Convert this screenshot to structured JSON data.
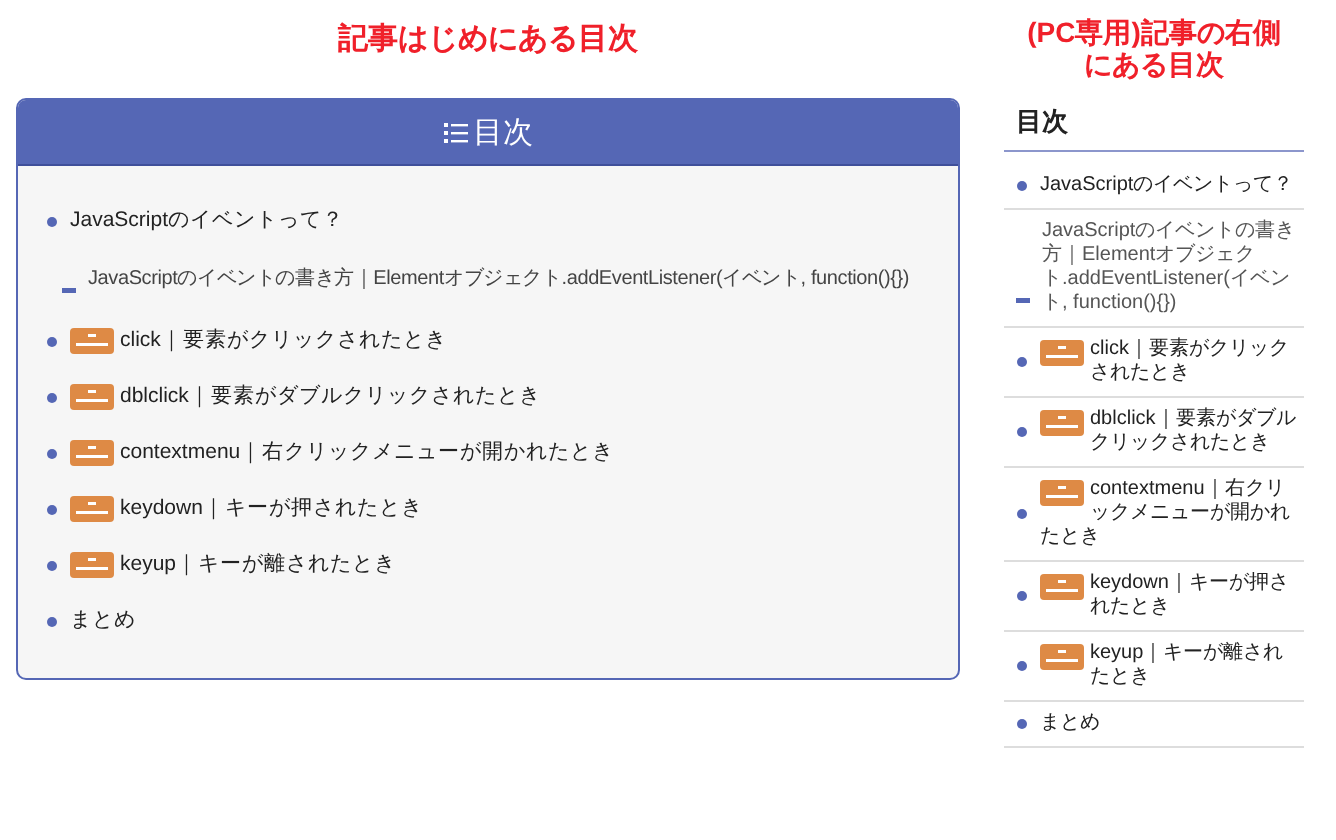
{
  "main_heading": "記事はじめにある目次",
  "toc": {
    "title": "目次",
    "items": [
      {
        "text": "JavaScriptのイベントって？",
        "event_badge": false,
        "children": [
          {
            "text": "JavaScriptのイベントの書き方｜Elementオブジェクト.addEventListener(イベント, function(){})",
            "event_badge": false
          }
        ]
      },
      {
        "text": "click｜要素がクリックされたとき",
        "event_badge": true
      },
      {
        "text": "dblclick｜要素がダブルクリックされたとき",
        "event_badge": true
      },
      {
        "text": "contextmenu｜右クリックメニューが開かれたとき",
        "event_badge": true
      },
      {
        "text": "keydown｜キーが押されたとき",
        "event_badge": true
      },
      {
        "text": "keyup｜キーが離されたとき",
        "event_badge": true
      },
      {
        "text": "まとめ",
        "event_badge": false
      }
    ]
  },
  "side_heading": [
    "(PC専用)記事の右側",
    "にある目次"
  ],
  "sidebar": {
    "title": "目次",
    "items": [
      {
        "text": "JavaScriptのイベントって？",
        "event_badge": false,
        "children": [
          {
            "text": "JavaScriptのイベントの書き方｜Elementオブジェクト.addEventListener(イベント, function(){})",
            "event_badge": false
          }
        ]
      },
      {
        "text": "click｜要素がクリックされたとき",
        "event_badge": true
      },
      {
        "text": "dblclick｜要素がダブルクリックされたとき",
        "event_badge": true
      },
      {
        "text": "contextmenu｜右クリックメニューが開かれたとき",
        "event_badge": true
      },
      {
        "text": "keydown｜キーが押されたとき",
        "event_badge": true
      },
      {
        "text": "keyup｜キーが離されたとき",
        "event_badge": true
      },
      {
        "text": "まとめ",
        "event_badge": false
      }
    ]
  }
}
